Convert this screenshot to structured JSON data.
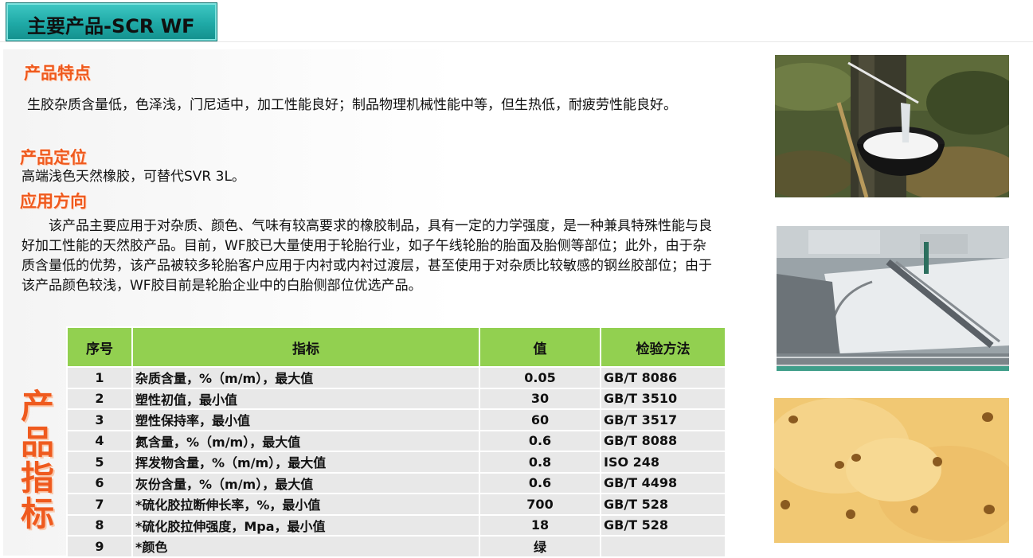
{
  "title": "主要产品-SCR WF",
  "sections": {
    "features": {
      "heading": "产品特点",
      "text": "生胶杂质含量低，色泽浅，门尼适中，加工性能良好；制品物理机械性能中等，但生热低，耐疲劳性能良好。"
    },
    "positioning": {
      "heading": "产品定位",
      "text": "高端浅色天然橡胶，可替代SVR 3L。"
    },
    "application": {
      "heading": "应用方向",
      "text": "该产品主要应用于对杂质、颜色、气味有较高要求的橡胶制品，具有一定的力学强度，是一种兼具特殊性能与良好加工性能的天然胶产品。目前，WF胶已大量使用于轮胎行业，如子午线轮胎的胎面及胎侧等部位；此外，由于杂质含量低的优势，该产品被较多轮胎客户应用于内衬或内衬过渡层，甚至使用于对杂质比较敏感的钢丝胶部位；由于该产品颜色较浅，WF胶目前是轮胎企业中的白胎侧部位优选产品。"
    }
  },
  "side_label": [
    "产",
    "品",
    "指",
    "标"
  ],
  "table": {
    "headers": [
      "序号",
      "指标",
      "值",
      "检验方法"
    ],
    "rows": [
      [
        "1",
        "杂质含量，%（m/m），最大值",
        "0.05",
        "GB/T 8086"
      ],
      [
        "2",
        "塑性初值，最小值",
        "30",
        "GB/T 3510"
      ],
      [
        "3",
        "塑性保持率，最小值",
        "60",
        "GB/T 3517"
      ],
      [
        "4",
        "氮含量，%（m/m），最大值",
        "0.6",
        "GB/T 8088"
      ],
      [
        "5",
        "挥发物含量，%（m/m），最大值",
        "0.8",
        "ISO 248"
      ],
      [
        "6",
        "灰份含量，%（m/m），最大值",
        "0.6",
        "GB/T 4498"
      ],
      [
        "7",
        "*硫化胶拉断伸长率，%，最小值",
        "700",
        "GB/T 528"
      ],
      [
        "8",
        "*硫化胶拉伸强度，Mpa，最小值",
        "18",
        "GB/T 528"
      ],
      [
        "9",
        "*颜色",
        "绿",
        ""
      ]
    ]
  },
  "colors": {
    "heading": "#ef5a1e",
    "table_header": "#92d050",
    "table_row": "#e8e8e8",
    "title_box": "#1fa9a6"
  },
  "images": [
    "latex-tapping-photo",
    "latex-pool-photo",
    "rubber-crumb-photo"
  ]
}
